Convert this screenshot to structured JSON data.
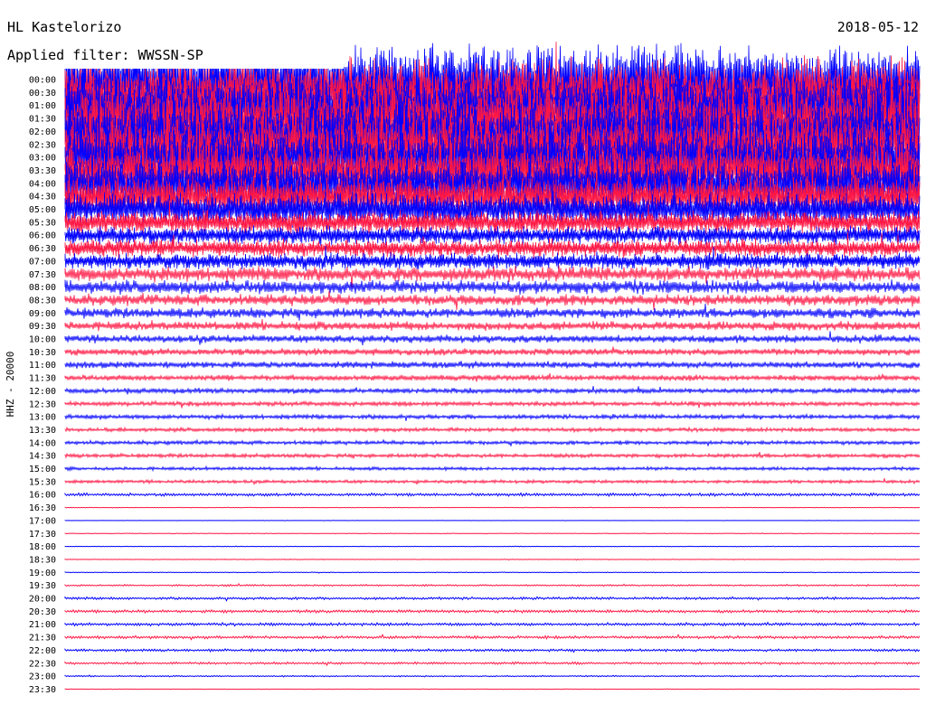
{
  "station": "HL Kastelorizo",
  "date": "2018-05-12",
  "filter_text": "Applied filter: WWSSN-SP",
  "channel_label": "HHZ - 20000",
  "colors": {
    "trace_a": "#0000ff",
    "trace_b": "#ff1744",
    "background": "#ffffff",
    "text": "#000000"
  },
  "chart_data": {
    "type": "line",
    "title": "HL Kastelorizo",
    "subtitle": "Applied filter: WWSSN-SP",
    "date": "2018-05-12",
    "ylabel": "HHZ - 20000",
    "row_labels": [
      "00:00",
      "00:30",
      "01:00",
      "01:30",
      "02:00",
      "02:30",
      "03:00",
      "03:30",
      "04:00",
      "04:30",
      "05:00",
      "05:30",
      "06:00",
      "06:30",
      "07:00",
      "07:30",
      "08:00",
      "08:30",
      "09:00",
      "09:30",
      "10:00",
      "10:30",
      "11:00",
      "11:30",
      "12:00",
      "12:30",
      "13:00",
      "13:30",
      "14:00",
      "14:30",
      "15:00",
      "15:30",
      "16:00",
      "16:30",
      "17:00",
      "17:30",
      "18:00",
      "18:30",
      "19:00",
      "19:30",
      "20:00",
      "20:30",
      "21:00",
      "21:30",
      "22:00",
      "22:30",
      "23:00",
      "23:30"
    ],
    "row_colors": [
      "trace_a",
      "trace_b"
    ],
    "relative_amplitude": [
      6,
      6,
      6,
      6,
      6,
      5.5,
      5.5,
      5,
      4.5,
      3.8,
      3,
      2,
      1.6,
      1.5,
      1.4,
      1.3,
      1.2,
      1,
      0.9,
      0.8,
      0.7,
      0.6,
      0.6,
      0.5,
      0.45,
      0.4,
      0.4,
      0.35,
      0.35,
      0.35,
      0.3,
      0.3,
      0.25,
      0.05,
      0.04,
      0.06,
      0.05,
      0.06,
      0.06,
      0.15,
      0.22,
      0.25,
      0.25,
      0.25,
      0.22,
      0.2,
      0.12,
      0.05
    ],
    "grid": false,
    "legend": "none"
  }
}
